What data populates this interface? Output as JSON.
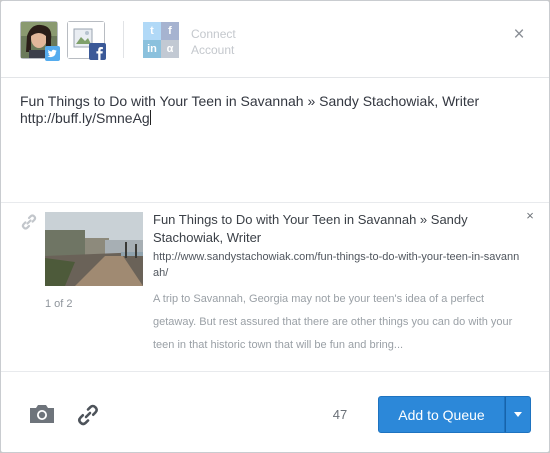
{
  "profiles": [
    {
      "network": "twitter",
      "icon": "twitter-profile-avatar"
    },
    {
      "network": "facebook",
      "icon": "facebook-page-avatar"
    }
  ],
  "connect_account": {
    "label": "Connect Account",
    "tile_icons": [
      "twitter-icon",
      "facebook-icon",
      "linkedin-icon",
      "app-net-icon"
    ],
    "tile_colors": [
      "#55acee",
      "#3b5998",
      "#0077b5",
      "#7a8aa0"
    ]
  },
  "composer": {
    "text": "Fun Things to Do with Your Teen in Savannah » Sandy Stachowiak, Writer http://buff.ly/SmneAg"
  },
  "attachment": {
    "title": "Fun Things to Do with Your Teen in Savannah » Sandy Stachowiak, Writer",
    "url": "http://www.sandystachowiak.com/fun-things-to-do-with-your-teen-in-savannah/",
    "description": "A trip to Savannah, Georgia may not be your teen's idea of a perfect getaway. But rest assured that there are other things you can do with your teen in that historic town that will be fun and bring...",
    "page_count": "1 of 2",
    "close_glyph": "×"
  },
  "footer": {
    "char_count": "47",
    "add_to_queue_label": "Add to Queue"
  },
  "colors": {
    "accent": "#2c88d9",
    "twitter": "#55acee",
    "facebook": "#3b5998"
  },
  "close_glyph": "×"
}
